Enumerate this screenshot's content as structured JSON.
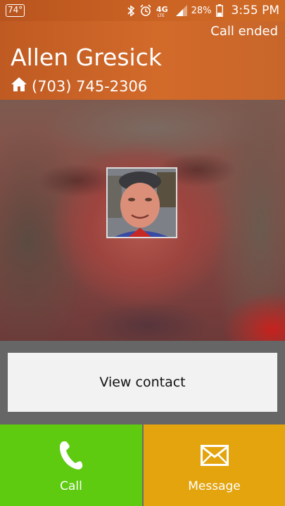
{
  "status_bar": {
    "temperature": "74°",
    "network": "4G LTE",
    "battery": "28%",
    "time": "3:55 PM"
  },
  "header": {
    "call_status": "Call ended",
    "contact_name": "Allen Gresick",
    "phone_number": "(703) 745-2306",
    "phone_type_icon": "home-icon"
  },
  "actions": {
    "view_contact": "View contact",
    "call": "Call",
    "message": "Message"
  },
  "colors": {
    "header": "#c8622a",
    "call": "#5ecb11",
    "message": "#e3a40e",
    "band": "#666666"
  }
}
